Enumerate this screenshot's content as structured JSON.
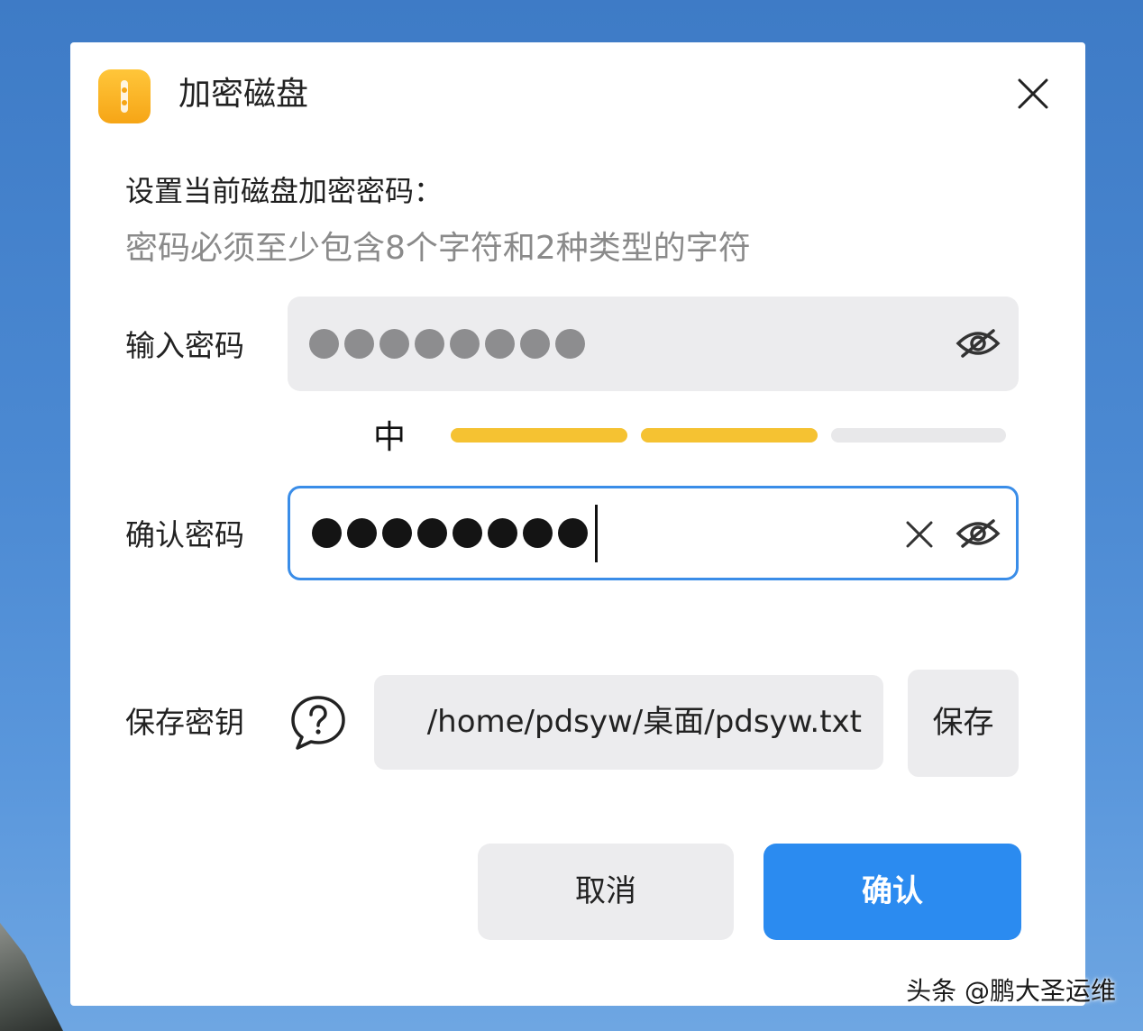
{
  "dialog": {
    "title": "加密磁盘",
    "heading": "设置当前磁盘加密密码：",
    "hint": "密码必须至少包含8个字符和2种类型的字符"
  },
  "password": {
    "label": "输入密码",
    "mask_count": 8
  },
  "strength": {
    "label": "中",
    "level": 2,
    "segments": 3,
    "colors": {
      "active": "#f5c232",
      "inactive": "#e8e8ea"
    }
  },
  "confirm_password": {
    "label": "确认密码",
    "mask_count": 8
  },
  "key": {
    "label": "保存密钥",
    "path": "/home/pdsyw/桌面/pdsyw.txt",
    "save_label": "保存"
  },
  "actions": {
    "cancel_label": "取消",
    "confirm_label": "确认"
  },
  "footer": {
    "credit": "头条 @鹏大圣运维"
  },
  "colors": {
    "accent": "#2b8bf0",
    "focus_border": "#3a8de8",
    "icon_yellow": "#f6a516"
  },
  "icons": [
    "archive-icon",
    "close-icon",
    "eye-off-icon",
    "clear-icon",
    "help-icon"
  ]
}
